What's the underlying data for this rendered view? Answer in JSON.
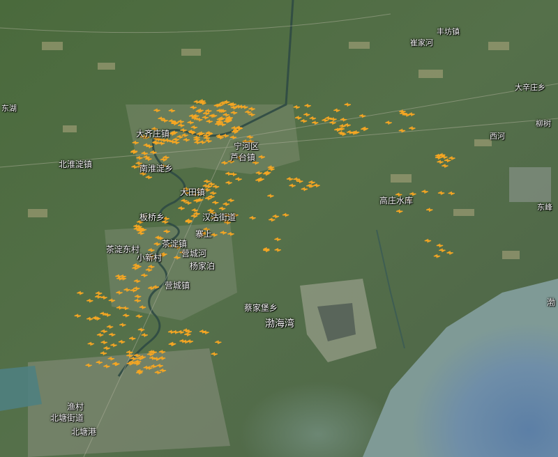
{
  "map": {
    "labels": [
      {
        "text": "丰坊镇"
      },
      {
        "text": "崔家河"
      },
      {
        "text": "大齐庄镇"
      },
      {
        "text": "宁河区"
      },
      {
        "text": "芦台镇"
      },
      {
        "text": "北淮淀镇"
      },
      {
        "text": "南淮淀乡"
      },
      {
        "text": "大田镇"
      },
      {
        "text": "板桥乡"
      },
      {
        "text": "汉沽街道"
      },
      {
        "text": "寨上"
      },
      {
        "text": "茶淀镇"
      },
      {
        "text": "营城河"
      },
      {
        "text": "杨家泊"
      },
      {
        "text": "茶淀东村"
      },
      {
        "text": "小新村"
      },
      {
        "text": "营城镇"
      },
      {
        "text": "蔡家堡乡"
      },
      {
        "text": "渤海湾"
      },
      {
        "text": "高庄水库"
      },
      {
        "text": "西河"
      },
      {
        "text": "大辛庄乡"
      },
      {
        "text": "柳树"
      },
      {
        "text": "东峰"
      },
      {
        "text": "渔村"
      },
      {
        "text": "北塘街道"
      },
      {
        "text": "北塘港"
      },
      {
        "text": "渤"
      },
      {
        "text": "东湖"
      }
    ],
    "marker_color": "#f5a623"
  }
}
